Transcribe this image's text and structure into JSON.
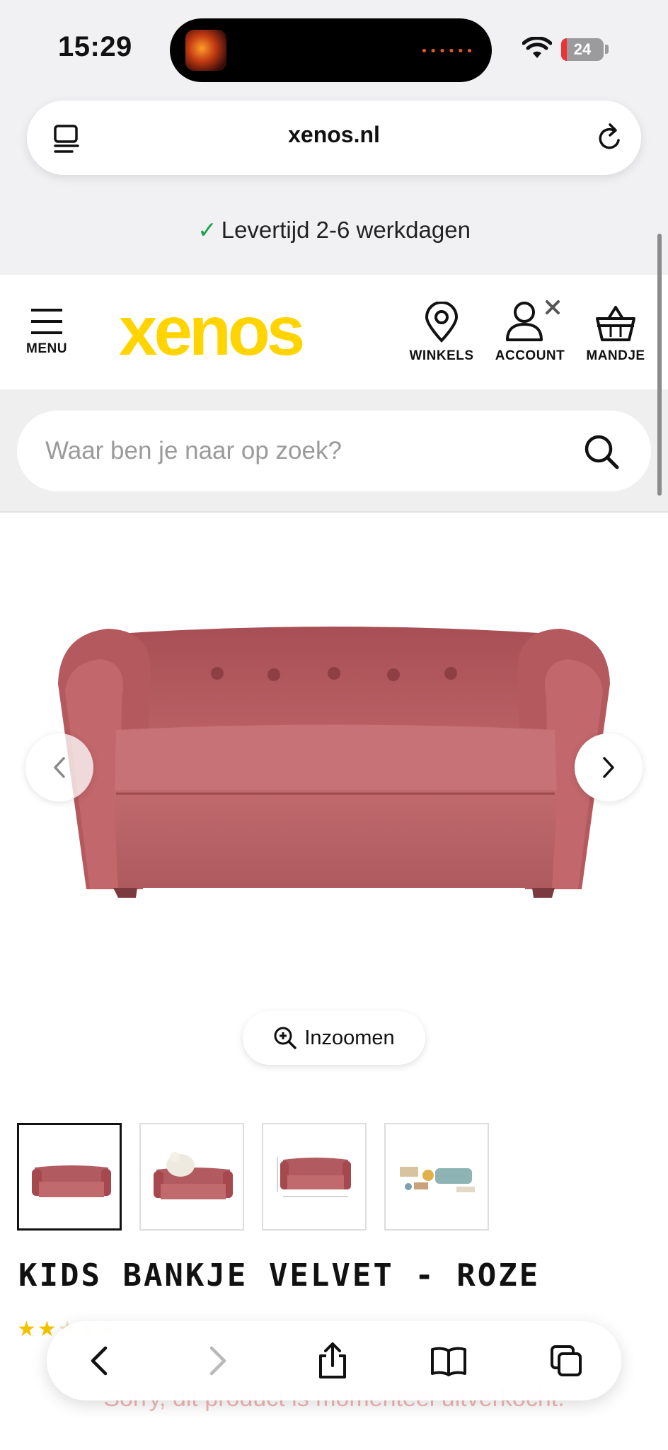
{
  "status_bar": {
    "time": "15:29",
    "battery": "24"
  },
  "browser": {
    "url": "xenos.nl"
  },
  "delivery": {
    "check": "✓",
    "text": "Levertijd 2-6 werkdagen"
  },
  "header": {
    "menu_label": "MENU",
    "logo": "xenos",
    "stores_label": "WINKELS",
    "account_label": "ACCOUNT",
    "cart_label": "MANDJE"
  },
  "search": {
    "placeholder": "Waar ben je naar op zoek?"
  },
  "gallery": {
    "zoom_label": "Inzoomen"
  },
  "product": {
    "title": "KIDS BANKJE VELVET - ROZE",
    "rating_stars": "★★",
    "rating_faded": "★★★",
    "sold_out": "Sorry, dit product is momenteel uitverkocht."
  },
  "colors": {
    "brand": "#ffd400",
    "sofa": "#b5595e",
    "check": "#1aa34a"
  },
  "icons": [
    "reader-icon",
    "reload-icon",
    "menu-icon",
    "location-pin-icon",
    "account-icon",
    "basket-icon",
    "search-icon",
    "chevron-left-icon",
    "chevron-right-icon",
    "zoom-in-icon",
    "share-icon",
    "bookmarks-icon",
    "tabs-icon"
  ]
}
